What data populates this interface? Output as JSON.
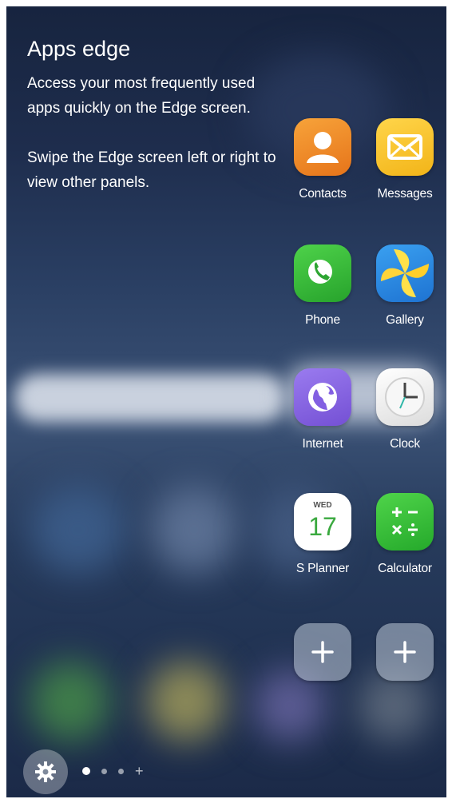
{
  "panel": {
    "title": "Apps edge",
    "description_1": "Access your most frequently used apps quickly on the Edge screen.",
    "description_2": "Swipe the Edge screen left or right to view other panels."
  },
  "apps": {
    "contacts": {
      "label": "Contacts",
      "icon": "contacts-icon",
      "color": "#f08a1c"
    },
    "messages": {
      "label": "Messages",
      "icon": "messages-icon",
      "color": "#f6c12a"
    },
    "phone": {
      "label": "Phone",
      "icon": "phone-icon",
      "color": "#3cbf3a"
    },
    "gallery": {
      "label": "Gallery",
      "icon": "gallery-icon",
      "color": "#2e8fe6"
    },
    "internet": {
      "label": "Internet",
      "icon": "internet-icon",
      "color": "#8a66e0"
    },
    "clock": {
      "label": "Clock",
      "icon": "clock-icon",
      "color": "#f1f1f1"
    },
    "splanner": {
      "label": "S Planner",
      "icon": "calendar-icon",
      "day": "WED",
      "date": "17",
      "color": "#ffffff"
    },
    "calculator": {
      "label": "Calculator",
      "icon": "calculator-icon",
      "color": "#38c23a"
    }
  },
  "add_slots": {
    "icon": "plus-icon"
  },
  "bottom_bar": {
    "settings_icon": "gear-icon",
    "page_indicator": {
      "pages": 3,
      "current": 1,
      "add_icon": "+"
    }
  }
}
